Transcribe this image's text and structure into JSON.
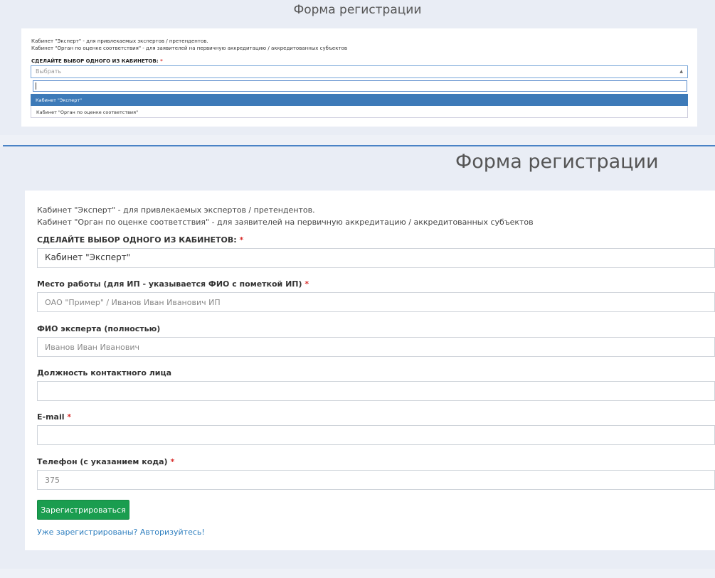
{
  "top": {
    "title": "Форма регистрации",
    "line1": "Кабинет \"Эксперт\" - для привлекаемых экспертов / претендентов.",
    "line2": "Кабинет \"Орган по оценке соответствия\" - для заявителей на первичную аккредитацию / аккредитованных субъектов",
    "choose_label": "СДЕЛАЙТЕ ВЫБОР ОДНОГО ИЗ КАБИНЕТОВ:",
    "required_mark": "*",
    "select_placeholder": "Выбрать",
    "caret": "▲",
    "options": [
      "Кабинет \"Эксперт\"",
      "Кабинет \"Орган по оценке соответствия\""
    ]
  },
  "main": {
    "title": "Форма регистрации",
    "line1": "Кабинет \"Эксперт\" - для привлекаемых экспертов / претендентов.",
    "line2": "Кабинет \"Орган по оценке соответствия\" - для заявителей на первичную аккредитацию / аккредитованных субъектов",
    "choose_label": "СДЕЛАЙТЕ ВЫБОР ОДНОГО ИЗ КАБИНЕТОВ:",
    "required_mark": "*",
    "cabinet_value": "Кабинет \"Эксперт\"",
    "workplace_label": "Место работы (для ИП - указывается ФИО с пометкой ИП)",
    "workplace_placeholder": "ОАО \"Пример\" / Иванов Иван Иванович ИП",
    "fio_label": "ФИО эксперта (полностью)",
    "fio_placeholder": "Иванов Иван Иванович",
    "position_label": "Должность контактного лица",
    "email_label": "E-mail",
    "phone_label": "Телефон (с указанием кода)",
    "phone_placeholder": "375",
    "submit_label": "Зарегистрироваться",
    "login_link": "Уже зарегистрированы? Авторизуйтесь!"
  }
}
